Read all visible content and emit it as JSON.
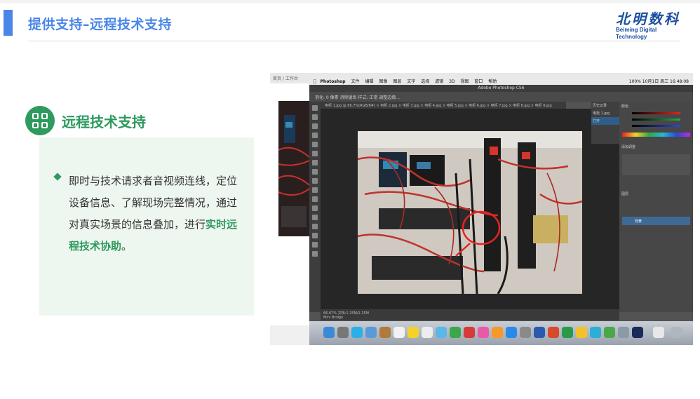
{
  "header": {
    "title": "提供支持–远程技术支持",
    "logo_cn": "北明数科",
    "logo_en": "Beiming Digital Technology"
  },
  "section": {
    "title": "远程技术支持",
    "icon": "grid-icon",
    "bullet_part1": "即时与技术请求者音视频连线，定位设备信息、了解现场完整情况，通过对真实场景的信息叠加，进行",
    "bullet_highlight": "实时远程技术协助",
    "bullet_part2": "。"
  },
  "screenshot": {
    "browser_breadcrumb": "首页 / 工作台",
    "menubar_items": [
      "Photoshop",
      "文件",
      "编辑",
      "图像",
      "图层",
      "文字",
      "选择",
      "滤镜",
      "3D",
      "视图",
      "窗口",
      "帮助"
    ],
    "menubar_status": "100%  10月1日 周三  16:48:08",
    "ps_title": "Adobe Photoshop CS6",
    "ps_options": "羽化: 0 像素    消除锯齿    样式: 正常    调整边缘...",
    "ps_doctabs": "电柜 1.jpg @ 66.7%(RGB/8#) × 电柜 2.jpg × 电柜 3.jpg × 电柜 4.jpg × 电柜 5.jpg × 电柜 6.jpg × 电柜 7.jpg × 电柜 8.jpg × 电柜 9.jpg",
    "ps_status": "66.67%   文档:1.25M/1.25M",
    "ps_minibridge": "Mini Bridge",
    "ps_panels": {
      "color_title": "颜色",
      "history_title": "历史记录",
      "adjust_title": "添加调整",
      "layers_title": "图层",
      "layer_bg": "背景",
      "history_item": "电柜 1.jpg",
      "history_item2": "打开"
    },
    "accent_red": "#e8231e",
    "accent_green": "#2e9a5e",
    "accent_blue": "#4a86e8"
  }
}
